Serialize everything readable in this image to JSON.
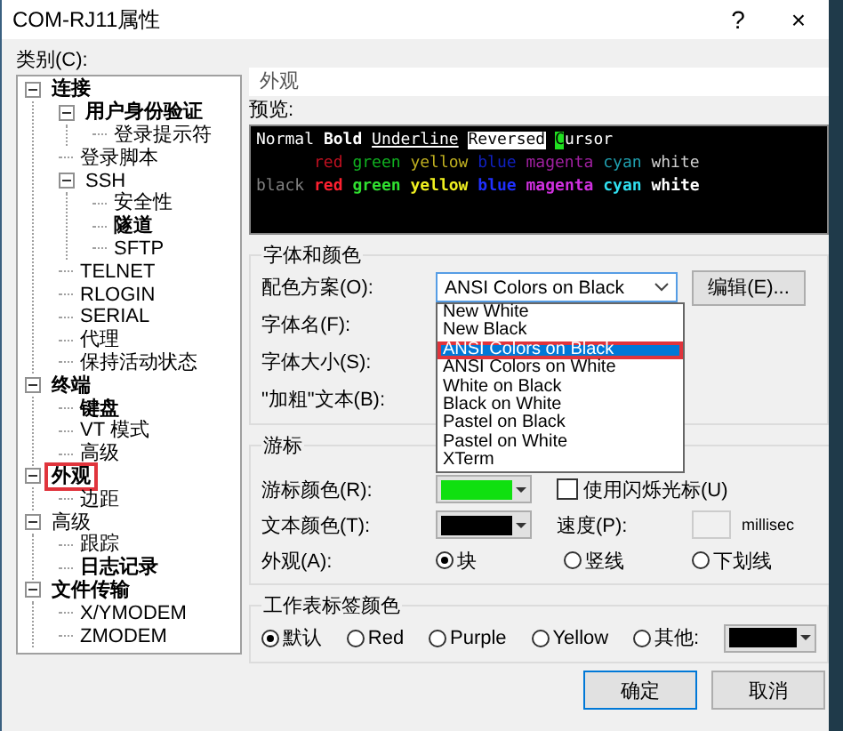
{
  "window": {
    "title": "COM-RJ11属性",
    "help": "?",
    "close": "×"
  },
  "category_label": "类别(C):",
  "tree": [
    {
      "label": "连接",
      "bold": true,
      "expanded": true,
      "marked": false,
      "children": [
        {
          "label": "用户身份验证",
          "bold": true,
          "expanded": true,
          "marked": false,
          "children": [
            {
              "label": "登录提示符",
              "bold": false,
              "marked": false
            }
          ]
        },
        {
          "label": "登录脚本",
          "bold": false,
          "marked": false
        },
        {
          "label": "SSH",
          "bold": false,
          "expanded": true,
          "marked": false,
          "children": [
            {
              "label": "安全性",
              "bold": false,
              "marked": false
            },
            {
              "label": "隧道",
              "bold": true,
              "marked": false
            },
            {
              "label": "SFTP",
              "bold": false,
              "marked": false
            }
          ]
        },
        {
          "label": "TELNET",
          "bold": false,
          "marked": false
        },
        {
          "label": "RLOGIN",
          "bold": false,
          "marked": false
        },
        {
          "label": "SERIAL",
          "bold": false,
          "marked": false
        },
        {
          "label": "代理",
          "bold": false,
          "marked": false
        },
        {
          "label": "保持活动状态",
          "bold": false,
          "marked": false
        }
      ]
    },
    {
      "label": "终端",
      "bold": true,
      "expanded": true,
      "marked": false,
      "children": [
        {
          "label": "键盘",
          "bold": true,
          "marked": false
        },
        {
          "label": "VT 模式",
          "bold": false,
          "marked": false
        },
        {
          "label": "高级",
          "bold": false,
          "marked": false
        }
      ]
    },
    {
      "label": "外观",
      "bold": true,
      "expanded": true,
      "marked": true,
      "children": [
        {
          "label": "边距",
          "bold": false,
          "marked": false
        }
      ]
    },
    {
      "label": "高级",
      "bold": false,
      "expanded": true,
      "marked": false,
      "children": [
        {
          "label": "跟踪",
          "bold": false,
          "marked": false
        },
        {
          "label": "日志记录",
          "bold": true,
          "marked": false
        }
      ]
    },
    {
      "label": "文件传输",
      "bold": true,
      "expanded": true,
      "marked": false,
      "children": [
        {
          "label": "X/YMODEM",
          "bold": false,
          "marked": false
        },
        {
          "label": "ZMODEM",
          "bold": false,
          "marked": false
        }
      ]
    }
  ],
  "section_title": "外观",
  "preview": {
    "label": "预览:",
    "lines": [
      {
        "indented": false,
        "words": [
          {
            "text": "Normal",
            "kind": "plain",
            "color": "#ffffff"
          },
          {
            "text": "Bold",
            "kind": "bold",
            "color": "#ffffff"
          },
          {
            "text": "Underline",
            "kind": "underline",
            "color": "#ffffff"
          },
          {
            "text": "Reversed",
            "kind": "reversed",
            "color": "#ffffff"
          },
          {
            "text": "Cursor",
            "kind": "cursor",
            "color": "#ffffff"
          }
        ]
      },
      {
        "indented": true,
        "words": [
          {
            "text": "red",
            "kind": "plain",
            "color": "#c01020"
          },
          {
            "text": "green",
            "kind": "plain",
            "color": "#10b020"
          },
          {
            "text": "yellow",
            "kind": "plain",
            "color": "#c0b020"
          },
          {
            "text": "blue",
            "kind": "plain",
            "color": "#1020c0"
          },
          {
            "text": "magenta",
            "kind": "plain",
            "color": "#a020a0"
          },
          {
            "text": "cyan",
            "kind": "plain",
            "color": "#20a0b0"
          },
          {
            "text": "white",
            "kind": "plain",
            "color": "#d0d0d0"
          }
        ]
      },
      {
        "indented": false,
        "words": [
          {
            "text": "black",
            "kind": "plain",
            "color": "#808080"
          },
          {
            "text": "red",
            "kind": "bold",
            "color": "#ff2030"
          },
          {
            "text": "green",
            "kind": "bold",
            "color": "#30e030"
          },
          {
            "text": "yellow",
            "kind": "bold",
            "color": "#f0f020"
          },
          {
            "text": "blue",
            "kind": "bold",
            "color": "#2030ff"
          },
          {
            "text": "magenta",
            "kind": "bold",
            "color": "#d030e0"
          },
          {
            "text": "cyan",
            "kind": "bold",
            "color": "#30e0f0"
          },
          {
            "text": "white",
            "kind": "bold",
            "color": "#ffffff"
          }
        ]
      }
    ]
  },
  "font_group": {
    "title": "字体和颜色",
    "scheme_label": "配色方案(O):",
    "scheme_value": "ANSI Colors on Black",
    "edit_button": "编辑(E)...",
    "font_name_label": "字体名(F):",
    "font_size_label": "字体大小(S):",
    "bold_text_label": "\"加粗\"文本(B):",
    "scheme_options": [
      {
        "label": "New White",
        "selected": false,
        "marked": false
      },
      {
        "label": "New Black",
        "selected": false,
        "marked": false
      },
      {
        "label": "ANSI Colors on Black",
        "selected": true,
        "marked": true
      },
      {
        "label": "ANSI Colors on White",
        "selected": false,
        "marked": false
      },
      {
        "label": "White on Black",
        "selected": false,
        "marked": false
      },
      {
        "label": "Black on White",
        "selected": false,
        "marked": false
      },
      {
        "label": "Pastel on Black",
        "selected": false,
        "marked": false
      },
      {
        "label": "Pastel on White",
        "selected": false,
        "marked": false
      },
      {
        "label": "XTerm",
        "selected": false,
        "marked": false
      }
    ]
  },
  "cursor_group": {
    "title": "游标",
    "cursor_color_label": "游标颜色(R):",
    "blink": {
      "label": "使用闪烁光标(U)",
      "checked": false
    },
    "text_color_label": "文本颜色(T):",
    "speed_label": "速度(P):",
    "speed_unit": "millisec",
    "shape_label": "外观(A):",
    "shapes": [
      {
        "label": "块",
        "selected": true
      },
      {
        "label": "竖线",
        "selected": false
      },
      {
        "label": "下划线",
        "selected": false
      }
    ]
  },
  "tab_color_group": {
    "title": "工作表标签颜色",
    "options": [
      {
        "label": "默认",
        "selected": true
      },
      {
        "label": "Red",
        "selected": false
      },
      {
        "label": "Purple",
        "selected": false
      },
      {
        "label": "Yellow",
        "selected": false
      },
      {
        "label": "其他:",
        "selected": false
      }
    ]
  },
  "buttons": [
    {
      "label": "确定",
      "default": true
    },
    {
      "label": "取消",
      "default": false
    }
  ]
}
